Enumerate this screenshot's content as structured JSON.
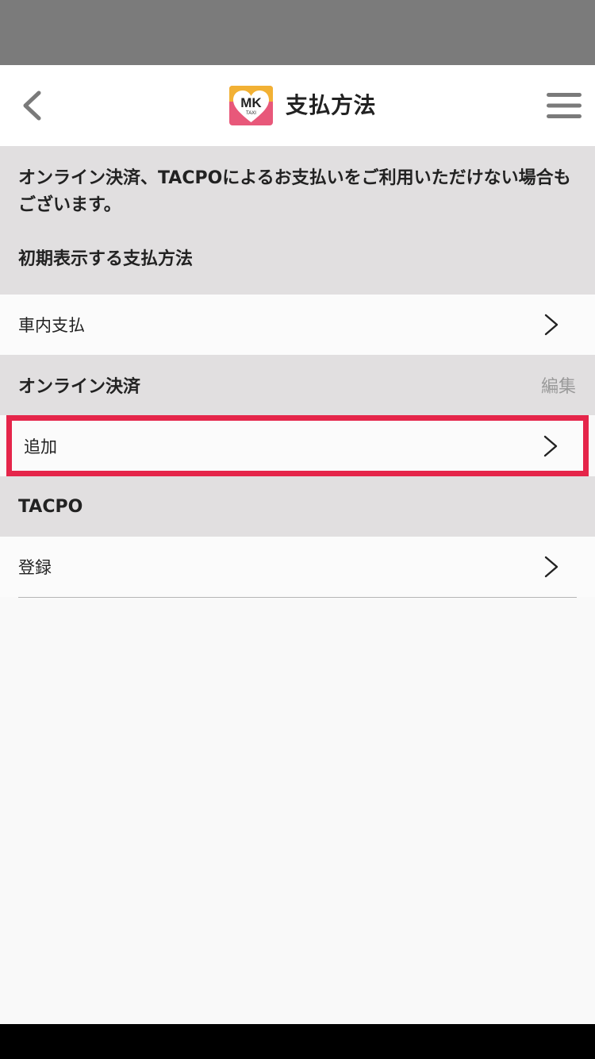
{
  "header": {
    "title": "支払方法",
    "logo_text": "MK",
    "logo_subtext": "TAXI"
  },
  "notice": {
    "text": "オンライン決済、TACPOによるお支払いをご利用いただけない場合もございます。"
  },
  "sections": {
    "default_payment": {
      "title": "初期表示する支払方法",
      "row_label": "車内支払"
    },
    "online_payment": {
      "title": "オンライン決済",
      "edit_label": "編集",
      "row_label": "追加"
    },
    "tacpo": {
      "title": "TACPO",
      "row_label": "登録"
    }
  },
  "colors": {
    "status_bar": "#7b7b7b",
    "section_bg": "#e1dfe0",
    "highlight_border": "#e5254a",
    "logo_pink": "#e8587a",
    "logo_orange": "#f2b134"
  }
}
